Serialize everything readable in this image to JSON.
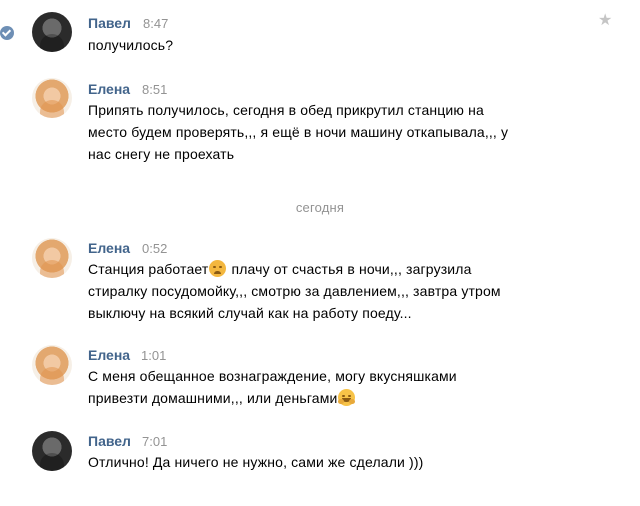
{
  "messages": [
    {
      "author": "Павел",
      "time": "8:47",
      "lines": [
        "получилось?"
      ]
    },
    {
      "author": "Елена",
      "time": "8:51",
      "lines": [
        "Припять получилось, сегодня в обед прикрутил станцию на",
        "место будем проверять,,, я ещё в ночи машину откапывала,,, у",
        "нас снегу не проехать"
      ]
    },
    {
      "author": "Елена",
      "time": "0:52",
      "lines": [
        "Станция работает",
        " плачу от счастья в ночи,,, загрузила",
        "стиралку посудомойку,,, смотрю за давлением,,, завтра утром",
        "выключу на всякий случай как на работу поеду..."
      ]
    },
    {
      "author": "Елена",
      "time": "1:01",
      "lines": [
        "С меня обещанное вознаграждение, могу вкусняшками",
        "привезти домашними,,, или деньгами"
      ]
    },
    {
      "author": "Павел",
      "time": "7:01",
      "lines": [
        "Отлично! Да ничего не нужно, сами же сделали )))"
      ]
    }
  ],
  "day_divider": "сегодня",
  "icons": {
    "selected": "check-circle-icon",
    "favorite": "star-icon",
    "emoji_1": "crying-face-emoji",
    "emoji_2": "hugging-face-emoji"
  },
  "colors": {
    "author_name": "#42648b",
    "meta_gray": "#939393",
    "check_blue": "#6e8fb5"
  }
}
